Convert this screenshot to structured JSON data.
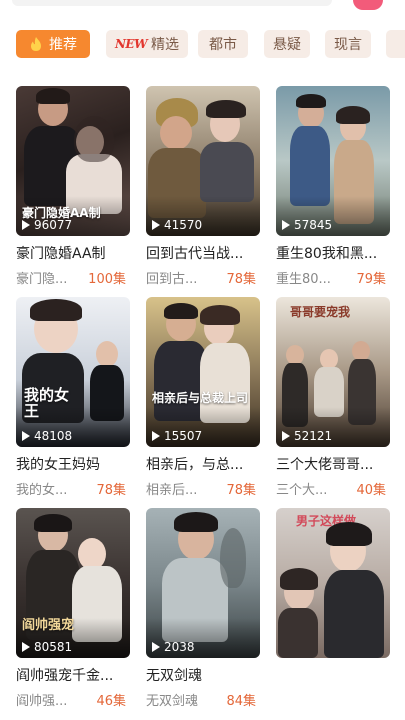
{
  "tabs": [
    {
      "label": "推荐",
      "active": true,
      "icon": "fire-icon"
    },
    {
      "label": "精选",
      "badge": "NEW"
    },
    {
      "label": "都市"
    },
    {
      "label": "悬疑"
    },
    {
      "label": "现言"
    }
  ],
  "dramas": [
    {
      "title": "豪门隐婚AA制",
      "subtitle": "豪门隐...",
      "episodes": "100集",
      "plays": "96077",
      "overlay": "豪门隐婚AA制"
    },
    {
      "title": "回到古代当战...",
      "subtitle": "回到古...",
      "episodes": "78集",
      "plays": "41570",
      "overlay": ""
    },
    {
      "title": "重生80我和黑...",
      "subtitle": "重生80...",
      "episodes": "79集",
      "plays": "57845",
      "overlay": ""
    },
    {
      "title": "我的女王妈妈",
      "subtitle": "我的女...",
      "episodes": "78集",
      "plays": "48108",
      "overlay": "我的女王"
    },
    {
      "title": "相亲后，与总...",
      "subtitle": "相亲后...",
      "episodes": "78集",
      "plays": "15507",
      "overlay": "相亲后与总裁上司"
    },
    {
      "title": "三个大佬哥哥...",
      "subtitle": "三个大...",
      "episodes": "40集",
      "plays": "52121",
      "overlay": "哥哥要宠我"
    },
    {
      "title": "阎帅强宠千金...",
      "subtitle": "阎帅强...",
      "episodes": "46集",
      "plays": "80581",
      "overlay": "阎帅强宠"
    },
    {
      "title": "无双剑魂",
      "subtitle": "无双剑魂",
      "episodes": "84集",
      "plays": "2038",
      "overlay": ""
    },
    {
      "title": "",
      "subtitle": "",
      "episodes": "",
      "plays": "",
      "overlay": "男子这样做"
    }
  ]
}
